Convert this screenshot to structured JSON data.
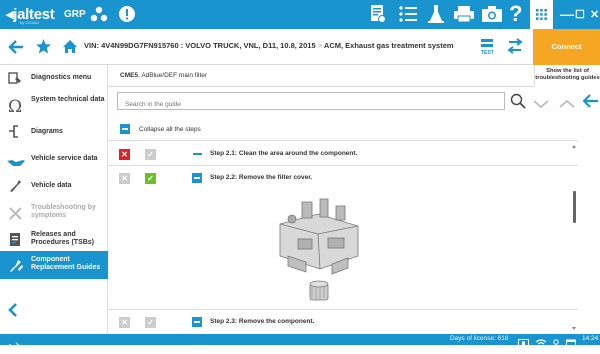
{
  "app": {
    "logo_text": "jaltest",
    "logo_sub": "by COJALI",
    "mode_label": "GRP"
  },
  "toolbar": {
    "icons": [
      "report-icon",
      "list-icon",
      "flask-icon",
      "printer-icon",
      "camera-icon",
      "help-icon",
      "grid-icon"
    ],
    "help_label": "?"
  },
  "window": {
    "minimize": "—",
    "maximize": "☐",
    "close": "✕"
  },
  "nav": {
    "vin_text": "VIN: 4V4N99DG7FN915760 : VOLVO TRUCK, VNL, D11, 10.8, 2015",
    "separator": ">",
    "system_text": "ACM, Exhaust gas treatment system",
    "connect_label": "Connect"
  },
  "sidebar": {
    "items": [
      {
        "label": "Diagnostics menu",
        "icon": "diagnostics-icon"
      },
      {
        "label": "System technical data",
        "icon": "omega-icon"
      },
      {
        "label": "Diagrams",
        "icon": "diagram-icon"
      },
      {
        "label": "Vehicle service data",
        "icon": "oil-can-icon"
      },
      {
        "label": "Vehicle data",
        "icon": "wrench-icon"
      },
      {
        "label": "Troubleshooting by symptoms",
        "icon": "tools-icon"
      },
      {
        "label": "Releases and Procedures (TSBs)",
        "icon": "document-icon"
      },
      {
        "label": "Component Replacement Guides",
        "icon": "replacement-icon"
      }
    ]
  },
  "main": {
    "title_code": "CME5",
    "title_rest": ", AdBlue/DEF main filter",
    "show_list_label": "Show the list of troubleshooting guides",
    "search_placeholder": "Search in the guide",
    "collapse_label": "Collapse all the steps",
    "steps": [
      {
        "label": "Step 2.1: Clean the area around the component.",
        "failed": true,
        "done": false
      },
      {
        "label": "Step 2.2: Remove the filter cover.",
        "failed": false,
        "done": true
      },
      {
        "label": "Step 2.3: Remove the component.",
        "failed": false,
        "done": false
      }
    ]
  },
  "status": {
    "days_license": "Days of license: 618",
    "time": "14:24"
  },
  "colors": {
    "brand_blue": "#1a94cf",
    "connect_orange": "#f5a623",
    "fail_red": "#d9262b",
    "ok_green": "#6cbf2a"
  }
}
